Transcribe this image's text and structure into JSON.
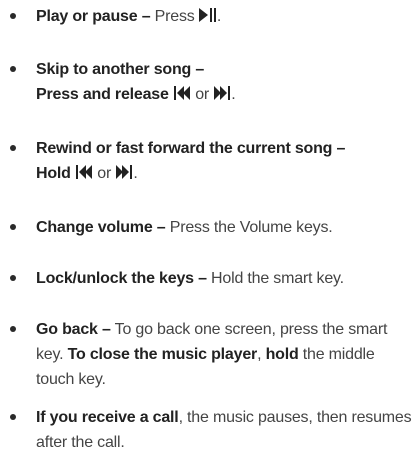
{
  "items": [
    {
      "label": "Play or pause –",
      "text_before_icon": "Press",
      "icon": "play-pause-icon",
      "tail": "."
    },
    {
      "label_line1": "Skip to another song –",
      "label_line2": "Press and release",
      "icon_a": "previous-track-icon",
      "or_text": "or",
      "icon_b": "next-track-icon",
      "tail": "."
    },
    {
      "label_line1": "Rewind or fast forward the current song –",
      "label_line2": "Hold",
      "icon_a": "previous-track-icon",
      "or_text": "or",
      "icon_b": "next-track-icon",
      "tail": "."
    },
    {
      "label": "Change volume –",
      "text": "Press the Volume keys."
    },
    {
      "label": "Lock/unlock the keys –",
      "text": "Hold the smart key."
    },
    {
      "label": "Go back –",
      "text1": "To go back one screen, press the smart key.",
      "bold2": "To close the music player",
      "comma": ",",
      "bold3": "hold",
      "text3": "the middle touch key."
    },
    {
      "label": "If you receive a call",
      "text": ", the music pauses, then resumes after the call."
    }
  ]
}
